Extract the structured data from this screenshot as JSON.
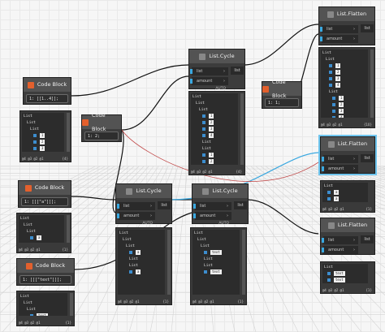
{
  "nodes": {
    "code_a": {
      "title": "Code Block",
      "code": "1: [[1..4]];",
      "foot": "@4 @3 @2 @1",
      "count": "{4}",
      "preview": [
        "List",
        "List",
        "List",
        "1",
        "2",
        "3",
        "4"
      ]
    },
    "code_b": {
      "title": "Code Block",
      "code": "1: 2;",
      "foot": "",
      "count": ""
    },
    "code_c": {
      "title": "Code Block",
      "code": "1: [[[\"a\"]]];",
      "foot": "@4 @3 @2 @1",
      "count": "{1}",
      "preview": [
        "List",
        "List",
        "List",
        "a"
      ]
    },
    "code_d": {
      "title": "Code Block",
      "code": "1: [[[\"text\"]]];",
      "foot": "@4 @3 @2 @1",
      "count": "{1}",
      "preview": [
        "List",
        "List",
        "List",
        "text"
      ]
    },
    "code_e": {
      "title": "Code Block",
      "code": "1: 1;",
      "foot": "",
      "count": ""
    },
    "cycle_top": {
      "title": "List.Cycle",
      "ports": [
        "list",
        "amount"
      ],
      "out": "list",
      "auto": "AUTO",
      "foot": "@4 @3 @2 @1",
      "count": "{4}",
      "preview": [
        "List",
        "List",
        "List",
        "1",
        "2",
        "3",
        "4",
        "List",
        "List",
        "1",
        "2",
        "3",
        "4"
      ]
    },
    "cycle_mid": {
      "title": "List.Cycle",
      "ports": [
        "list",
        "amount"
      ],
      "out": "list",
      "auto": "AUTO",
      "foot": "@4 @3 @2 @1",
      "count": "{1}",
      "preview": [
        "List",
        "List",
        "List",
        "a",
        "List",
        "List",
        "a"
      ]
    },
    "cycle_mid2": {
      "title": "List.Cycle",
      "ports": [
        "list",
        "amount"
      ],
      "out": "list",
      "auto": "AUTO",
      "foot": "@4 @3 @2 @1",
      "count": "{1}",
      "preview": [
        "List",
        "List",
        "List",
        "text",
        "List",
        "List",
        "text"
      ]
    },
    "flat_top": {
      "title": "List.Flatten",
      "ports": [
        "list",
        "amount"
      ],
      "out": "list",
      "auto": "AUTO",
      "foot": "@4 @3 @2 @1",
      "count": "{10}",
      "preview": [
        "List",
        "List",
        "1",
        "2",
        "3",
        "4",
        "List",
        "1",
        "2",
        "3",
        "4"
      ]
    },
    "flat_mid": {
      "title": "List.Flatten",
      "ports": [
        "list",
        "amount"
      ],
      "out": "list",
      "auto": "AUTO",
      "foot": "@4 @3 @2 @1",
      "count": "{1}",
      "preview": [
        "List",
        "a",
        "a"
      ]
    },
    "flat_bot": {
      "title": "List.Flatten",
      "ports": [
        "list",
        "amount"
      ],
      "out": "list",
      "auto": "AUTO",
      "foot": "@4 @3 @2 @1",
      "count": "{1}",
      "preview": [
        "List",
        "text",
        "text"
      ]
    }
  },
  "colors": {
    "accent": "#3aa8e0",
    "header": "#535353",
    "node": "#3c3c3c",
    "select": "#6fc5ee",
    "codeIcon": "#e3602d"
  }
}
